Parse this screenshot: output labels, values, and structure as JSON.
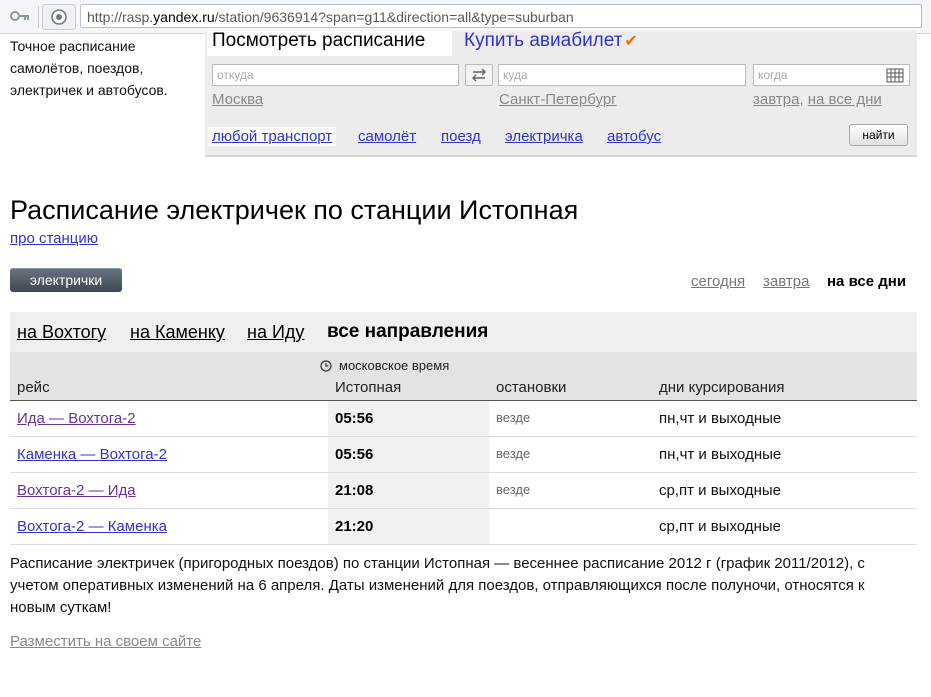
{
  "browser": {
    "url_prefix": "http://rasp.",
    "url_domain": "yandex.ru",
    "url_path": "/station/9636914?span=g11&direction=all&type=suburban"
  },
  "promo": {
    "text_lines": [
      "Точное расписание",
      "самолётов, поездов,",
      "электричек и автобусов."
    ]
  },
  "search": {
    "tabs": [
      {
        "label": "Посмотреть расписание"
      },
      {
        "label": "Купить авиабилет"
      }
    ],
    "from": {
      "placeholder": "откуда",
      "suggestion": "Москва"
    },
    "to": {
      "placeholder": "куда",
      "suggestion": "Санкт-Петербург"
    },
    "when": {
      "placeholder": "когда",
      "suggestion_1": "завтра",
      "suggestion_2": "на все дни"
    },
    "transport": [
      "любой транспорт",
      "самолёт",
      "поезд",
      "электричка",
      "автобус"
    ],
    "find_label": "найти"
  },
  "page": {
    "title": "Расписание электричек по станции Истопная",
    "about_link": "про станцию",
    "type_pill": "электрички",
    "days": {
      "today": "сегодня",
      "tomorrow": "завтра",
      "all": "на все дни"
    }
  },
  "directions": {
    "items": [
      "на Вохтогу",
      "на Каменку",
      "на Иду"
    ],
    "active": "все направления"
  },
  "table": {
    "timezone": "московское время",
    "headers": {
      "route": "рейс",
      "station": "Истопная",
      "stops": "остановки",
      "days": "дни курсирования"
    },
    "rows": [
      {
        "route": "Ида — Вохтога-2",
        "time": "05:56",
        "stops": "везде",
        "days": "пн,чт и выходные"
      },
      {
        "route": "Каменка — Вохтога-2",
        "time": "05:56",
        "stops": "везде",
        "days": "пн,чт и выходные"
      },
      {
        "route": "Вохтога-2 — Ида",
        "time": "21:08",
        "stops": "везде",
        "days": "ср,пт и выходные"
      },
      {
        "route": "Вохтога-2 — Каменка",
        "time": "21:20",
        "stops": "",
        "days": "ср,пт и выходные"
      }
    ]
  },
  "footer": {
    "note": "Расписание электричек (пригородных поездов) по станции Истопная — весеннее расписание 2012 г (график 2011/2012), с учетом оперативных изменений на 6 апреля. Даты изменений для поездов, отправляющихся после полуночи, относятся к новым суткам!",
    "place_link": "Разместить на своем сайте"
  },
  "colors": {
    "link": "#3333cc",
    "visited": "#663399",
    "accent_check": "#ff6600"
  }
}
